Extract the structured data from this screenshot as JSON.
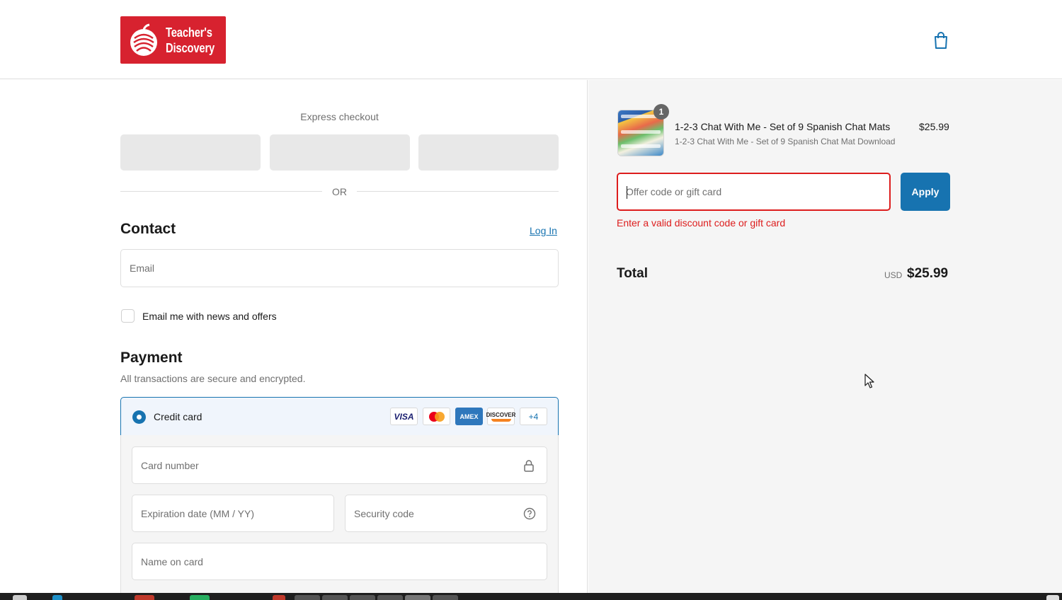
{
  "brand": {
    "line1": "Teacher's",
    "line2": "Discovery",
    "color": "#d7222f"
  },
  "header": {
    "cart_icon": "shopping-bag-icon"
  },
  "express": {
    "title": "Express checkout",
    "divider": "OR"
  },
  "contact": {
    "heading": "Contact",
    "login_label": "Log In",
    "email_placeholder": "Email",
    "newsletter_label": "Email me with news and offers"
  },
  "payment": {
    "heading": "Payment",
    "subtitle": "All transactions are secure and encrypted.",
    "method_label": "Credit card",
    "card_brands": [
      "VISA",
      "Mastercard",
      "AMEX",
      "DISCOVER"
    ],
    "more_label": "+4",
    "card_number_placeholder": "Card number",
    "expiry_placeholder": "Expiration date (MM / YY)",
    "security_placeholder": "Security code",
    "name_placeholder": "Name on card"
  },
  "summary": {
    "item": {
      "title": "1-2-3 Chat With Me - Set of 9 Spanish Chat Mats",
      "variant": "1-2-3 Chat With Me - Set of 9 Spanish Chat Mat Download",
      "price": "$25.99",
      "quantity": "1"
    },
    "offer_placeholder": "Offer code or gift card",
    "apply_label": "Apply",
    "offer_error": "Enter a valid discount code or gift card",
    "total_label": "Total",
    "currency": "USD",
    "total": "$25.99"
  },
  "colors": {
    "accent": "#1773b0",
    "error": "#dd1d1d",
    "sidebar_bg": "#f5f5f5"
  }
}
